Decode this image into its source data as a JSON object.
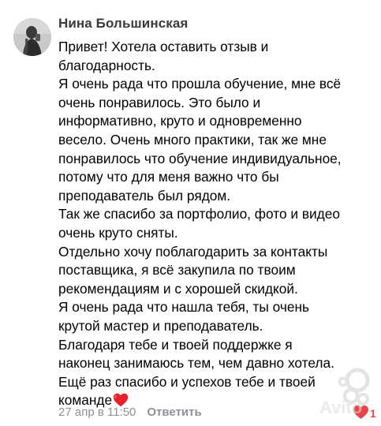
{
  "comment": {
    "author": "Нина Большинская",
    "lines": [
      "Привет! Хотела оставить отзыв и",
      "благодарность.",
      "Я очень рада что прошла обучение, мне всё",
      "очень понравилось. Это было и",
      "информативно, круто и одновременно",
      "весело. Очень много практики, так же мне",
      "понравилось что обучение индивидуальное,",
      "потому что для меня важно что бы",
      "преподаватель был рядом.",
      "Так же спасибо за портфолио, фото и видео",
      "очень круто сняты.",
      "Отдельно хочу поблагодарить за контакты",
      "поставщика, я всё закупила по твоим",
      "рекомендациям и с хорошей скидкой.",
      "Я очень рада что нашла тебя, ты очень",
      "крутой мастер и преподаватель.",
      "Благодаря тебе и твоей поддержке я",
      "наконец занимаюсь тем, чем давно хотела.",
      "Ещё раз спасибо и успехов тебе и твоей",
      "команде"
    ],
    "trailing_emoji": "red-heart-emoji",
    "timestamp": "27 апр в 11:50",
    "reply_label": "Ответить",
    "like_icon": "heart-icon",
    "like_count": "1"
  },
  "watermark": {
    "text": "Avito"
  },
  "colors": {
    "author": "#3a3a3a",
    "meta": "#8e9197",
    "like": "#e64646",
    "text": "#000000"
  }
}
